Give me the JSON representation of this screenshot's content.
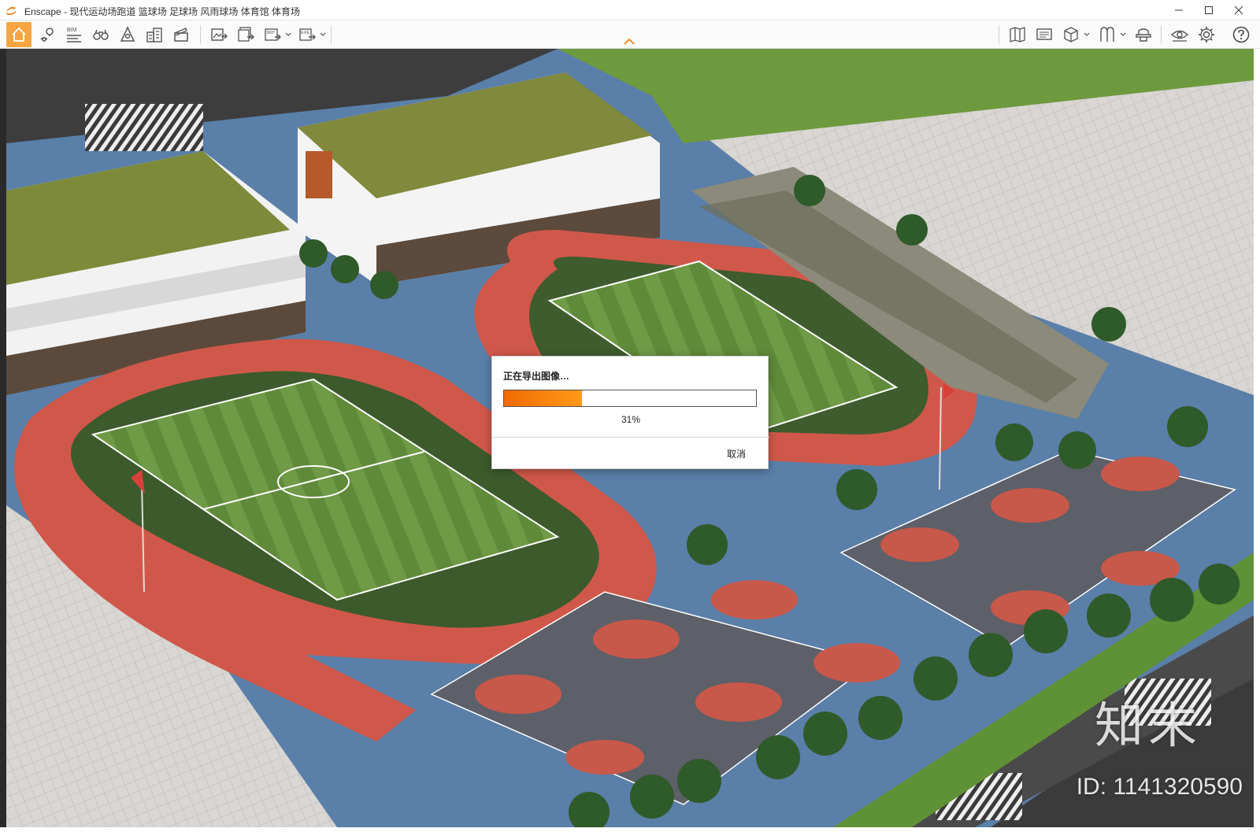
{
  "window": {
    "title": "Enscape - 现代运动场跑道 篮球场 足球场 风雨球场 体育馆 体育场",
    "controls": {
      "minimize": "minimize-icon",
      "maximize": "maximize-icon",
      "close": "close-icon"
    }
  },
  "toolbar": {
    "left_items": [
      {
        "name": "home-icon",
        "active": true
      },
      {
        "name": "map-pin-icon"
      },
      {
        "name": "bim-icon",
        "label": "BIM"
      },
      {
        "name": "binoculars-icon"
      },
      {
        "name": "light-view-icon"
      },
      {
        "name": "buildings-icon"
      },
      {
        "name": "clapperboard-icon"
      },
      {
        "name": "export-image-icon"
      },
      {
        "name": "batch-export-icon"
      },
      {
        "name": "panorama-360-icon",
        "label": "360°",
        "has_menu": true
      },
      {
        "name": "export-exe-icon",
        "label": "EXE",
        "has_menu": true
      }
    ],
    "right_items": [
      {
        "name": "map-icon"
      },
      {
        "name": "screen-icon"
      },
      {
        "name": "cube-icon",
        "has_menu": true
      },
      {
        "name": "asset-library-icon",
        "has_menu": true
      },
      {
        "name": "hat-icon"
      },
      {
        "name": "visual-settings-icon"
      },
      {
        "name": "settings-icon"
      },
      {
        "name": "help-icon"
      }
    ],
    "accent_color": "#f7a541"
  },
  "viewport": {
    "watermark": {
      "brand": "知末",
      "id": "ID: 1141320590"
    }
  },
  "dialog": {
    "title": "正在导出图像…",
    "progress": 0.31,
    "progress_text": "31%",
    "cancel_label": "取消",
    "progress_color": "#f57c00"
  }
}
